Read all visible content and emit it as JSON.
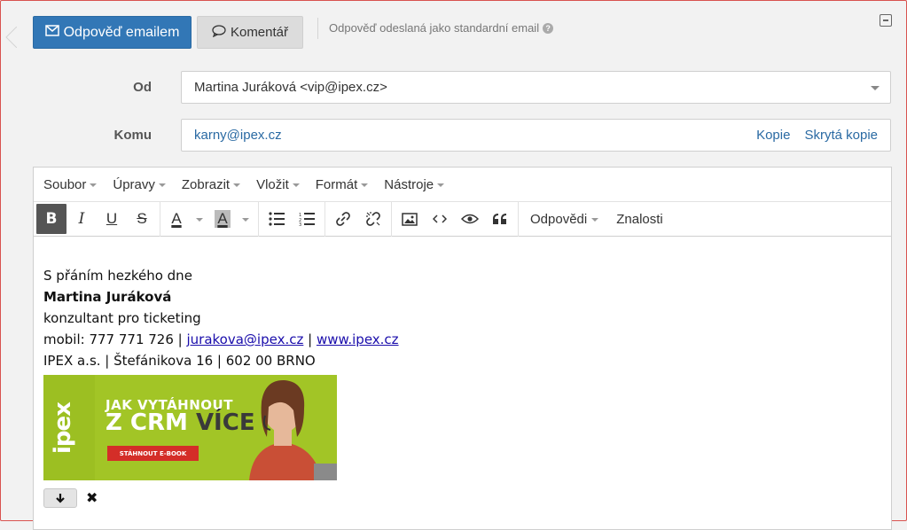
{
  "top": {
    "reply_email_label": "Odpověď emailem",
    "comment_label": "Komentář",
    "info_text": "Odpověď odeslaná jako standardní email",
    "help_glyph": "?"
  },
  "form": {
    "from_label": "Od",
    "from_value": "Martina Juráková <vip@ipex.cz>",
    "to_label": "Komu",
    "to_value": "karny@ipex.cz",
    "cc_label": "Kopie",
    "bcc_label": "Skrytá kopie"
  },
  "menubar": [
    "Soubor",
    "Úpravy",
    "Zobrazit",
    "Vložit",
    "Formát",
    "Nástroje"
  ],
  "toolbar": {
    "bold": "B",
    "italic": "I",
    "underline": "U",
    "strike": "S",
    "font_color": "A",
    "bg_color": "A",
    "responses_label": "Odpovědi",
    "knowledge_label": "Znalosti"
  },
  "signature": {
    "greeting": "S přáním hezkého dne",
    "name": "Martina Juráková",
    "role": "konzultant pro ticketing",
    "mobile_prefix": "mobil: 777 771 726 | ",
    "email": "jurakova@ipex.cz",
    "sep": " | ",
    "web": "www.ipex.cz",
    "address": "IPEX a.s. | Štefánikova 16 | 602 00 BRNO"
  },
  "banner": {
    "logo": "ipex",
    "line1": "JAK VYTÁHNOUT",
    "line2_a": "Z CRM ",
    "line2_b": "VÍCE",
    "cta": "STÁHNOUT E-BOOK"
  },
  "colors": {
    "primary": "#3277b6",
    "link": "#2a6aa3",
    "banner_green": "#a2c526",
    "cta_red": "#d42e28",
    "frame_red": "#d9534f"
  }
}
